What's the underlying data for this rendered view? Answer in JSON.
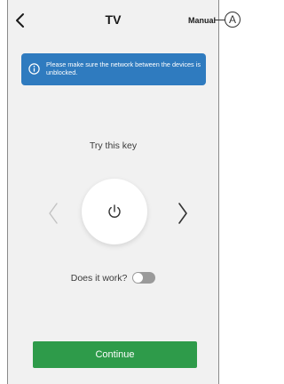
{
  "header": {
    "title": "TV",
    "manual_label": "Manual",
    "back_icon": "chevron-left-icon"
  },
  "banner": {
    "icon": "info-icon",
    "text": "Please make sure the network between the devices is unblocked."
  },
  "main": {
    "prompt": "Try this key",
    "key_icon": "power-icon",
    "prev_icon": "chevron-left-icon",
    "next_icon": "chevron-right-icon"
  },
  "works": {
    "label": "Does it work?",
    "toggle_on": false
  },
  "footer": {
    "continue_label": "Continue"
  },
  "callout": {
    "label": "A"
  },
  "colors": {
    "banner": "#2f7bbf",
    "continue": "#2e9b4a",
    "background": "#f1f1f1",
    "toggle_off": "#9a9a9a"
  }
}
